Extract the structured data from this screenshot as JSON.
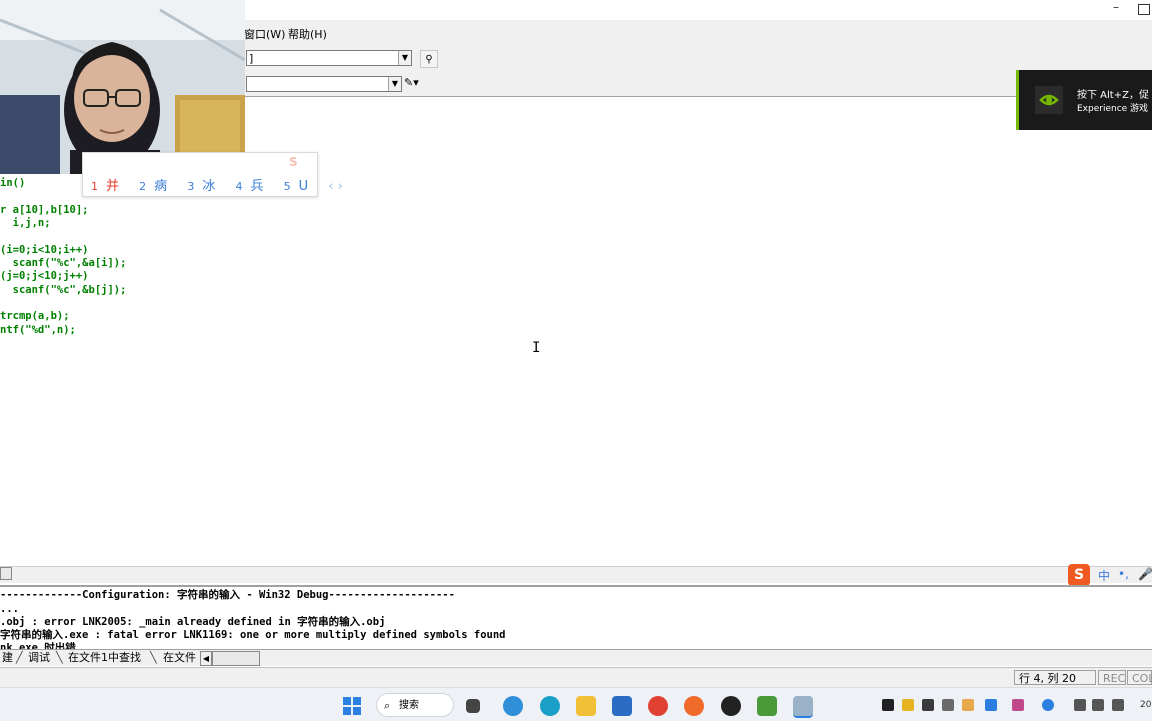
{
  "menu": {
    "window": "窗口(W)",
    "help": "帮助(H)"
  },
  "toolbar": {
    "combo1_value": "]",
    "combo2_value": ""
  },
  "ime_candidates": [
    {
      "num": "1",
      "word": "并"
    },
    {
      "num": "2",
      "word": "病"
    },
    {
      "num": "3",
      "word": "冰"
    },
    {
      "num": "4",
      "word": "兵"
    },
    {
      "num": "5",
      "word": "U"
    }
  ],
  "ime_nav": "‹ ›",
  "code_lines": [
    "in()",
    "",
    "r a[10],b[10];",
    "  i,j,n;",
    "",
    "(i=0;i<10;i++)",
    "  scanf(\"%c\",&a[i]);",
    "(j=0;j<10;j++)",
    "  scanf(\"%c\",&b[j]);",
    "",
    "trcmp(a,b);",
    "ntf(\"%d\",n);"
  ],
  "nvidia": {
    "line1": "按下 Alt+Z，促",
    "line2": "Experience 游戏"
  },
  "ime_status": {
    "logo": "S",
    "mode": "中",
    "punct": "•,",
    "mic": "🎤"
  },
  "output_lines": [
    "-------------Configuration: 字符串的输入 - Win32 Debug--------------------",
    "...",
    ".obj : error LNK2005: _main already defined in 字符串的输入.obj",
    "字符串的输入.exe : fatal error LNK1169: one or more multiply defined symbols found",
    "nk.exe 时出错"
  ],
  "output_tabs": [
    "建",
    "调试",
    "在文件1中查找",
    "在文件"
  ],
  "statusbar": {
    "position": "行 4, 列 20",
    "rec": "REC",
    "col": "COL"
  },
  "taskbar": {
    "search": "搜索",
    "clock": "20"
  }
}
